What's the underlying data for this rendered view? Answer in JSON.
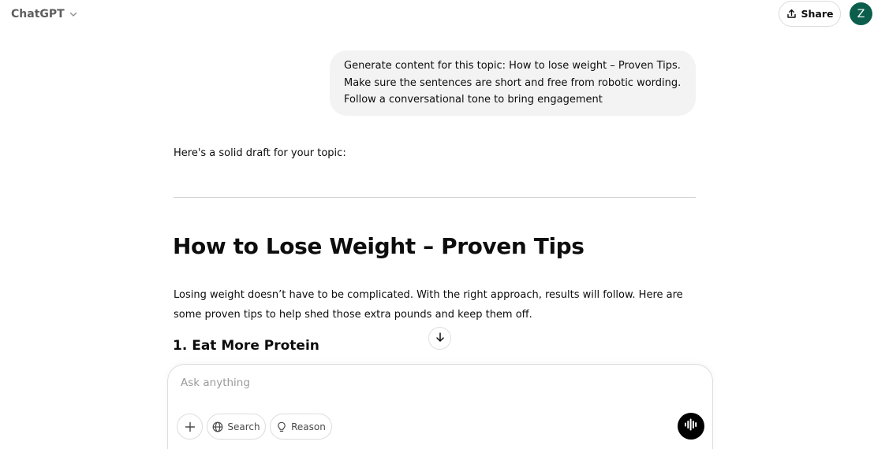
{
  "header": {
    "model_name": "ChatGPT",
    "share_label": "Share",
    "avatar_initial": "Z"
  },
  "conversation": {
    "user_message": {
      "lines": [
        "Generate content for this topic: How to lose weight – Proven Tips.",
        "Make sure the sentences are short and free from robotic wording.",
        "Follow a conversational tone to bring engagement"
      ]
    },
    "assistant": {
      "intro": "Here's a solid draft for your topic:",
      "heading": "How to Lose Weight – Proven Tips",
      "paragraph_lines": [
        "Losing weight doesn’t have to be complicated. With the right approach, results will follow. Here are",
        "some proven tips to help shed those extra pounds and keep them off."
      ],
      "subheading": "1. Eat More Protein"
    }
  },
  "composer": {
    "placeholder": "Ask anything",
    "value": "",
    "search_label": "Search",
    "reason_label": "Reason"
  },
  "icons": {
    "model_chevron": "chevron-down-icon",
    "share": "upload-icon",
    "scroll": "arrow-down-icon",
    "attach": "plus-icon",
    "search": "globe-icon",
    "reason": "lightbulb-icon",
    "voice": "voice-waveform-icon"
  },
  "colors": {
    "avatar_bg": "#0b5e4c",
    "user_bubble_bg": "#f3f3f3",
    "voice_button_bg": "#000000"
  }
}
